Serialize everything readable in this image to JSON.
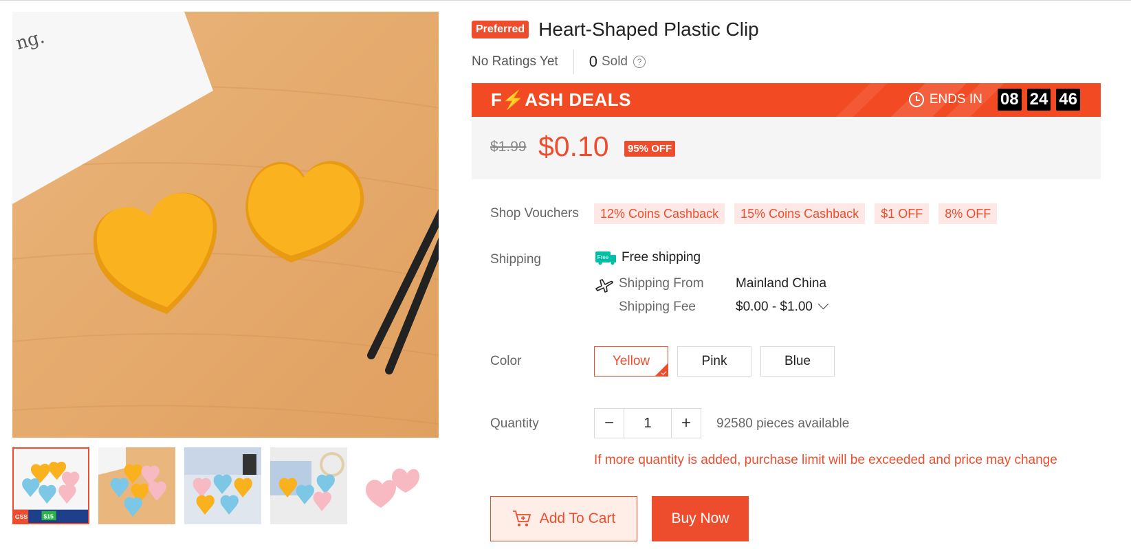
{
  "product": {
    "badge": "Preferred",
    "title": "Heart-Shaped Plastic Clip",
    "rating_text": "No Ratings Yet",
    "sold_count": "0",
    "sold_label": "Sold",
    "help_glyph": "?"
  },
  "flash": {
    "logo": "F⚡ASH DEALS",
    "ends_label": "ENDS IN",
    "hours": "08",
    "minutes": "24",
    "seconds": "46"
  },
  "price": {
    "original": "$1.99",
    "current": "$0.10",
    "discount": "95% OFF"
  },
  "vouchers": {
    "label": "Shop Vouchers",
    "items": [
      "12% Coins Cashback",
      "15% Coins Cashback",
      "$1 OFF",
      "8% OFF"
    ]
  },
  "shipping": {
    "label": "Shipping",
    "free_badge": "Free",
    "free_text": "Free shipping",
    "from_key": "Shipping From",
    "from_val": "Mainland China",
    "fee_key": "Shipping Fee",
    "fee_val": "$0.00 - $1.00"
  },
  "color": {
    "label": "Color",
    "options": [
      "Yellow",
      "Pink",
      "Blue"
    ],
    "selected": "Yellow"
  },
  "quantity": {
    "label": "Quantity",
    "minus": "−",
    "value": "1",
    "plus": "+",
    "available": "92580 pieces available",
    "warning": "If more quantity is added, purchase limit will be exceeded and price may change"
  },
  "actions": {
    "add_to_cart": "Add To Cart",
    "buy_now": "Buy Now"
  },
  "thumbnails": {
    "first_banner_text": "GSS",
    "first_banner_price": "$15"
  },
  "colors": {
    "accent": "#ee4d2d",
    "flash_bg": "#f24b23",
    "heart_yellow": "#f9b11e",
    "heart_pink": "#f7b9c2",
    "heart_blue": "#7cc7e6"
  }
}
